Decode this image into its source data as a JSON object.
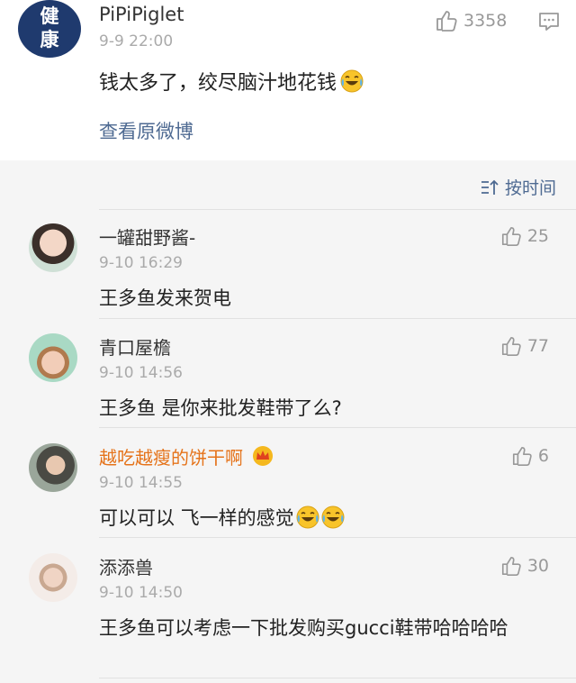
{
  "post": {
    "avatar_text": [
      "健",
      "康"
    ],
    "username": "PiPiPiglet",
    "time": "9-9 22:00",
    "like_count": "3358",
    "text": "钱太多了，绞尽脑汁地花钱",
    "view_original": "查看原微博",
    "colors": {
      "avatar_bg": "#1f3a6e",
      "link": "#4e6a92"
    }
  },
  "sort": {
    "label": "按时间",
    "icon": "sort-icon"
  },
  "comments": [
    {
      "username": "一罐甜野酱-",
      "time": "9-10 16:29",
      "likes": "25",
      "text": "王多鱼发来贺电",
      "vip": false
    },
    {
      "username": "青口屋檐",
      "time": "9-10 14:56",
      "likes": "77",
      "text": "王多鱼 是你来批发鞋带了么?",
      "vip": false
    },
    {
      "username": "越吃越瘦的饼干啊",
      "time": "9-10 14:55",
      "likes": "6",
      "text": "可以可以 飞一样的感觉",
      "vip": true
    },
    {
      "username": "添添兽",
      "time": "9-10 14:50",
      "likes": "30",
      "text": "王多鱼可以考虑一下批发购买gucci鞋带哈哈哈哈",
      "vip": false
    }
  ],
  "icons": [
    "thumbs-up-icon",
    "comment-icon",
    "laughing-crying-emoji",
    "crown-icon",
    "sort-icon"
  ]
}
